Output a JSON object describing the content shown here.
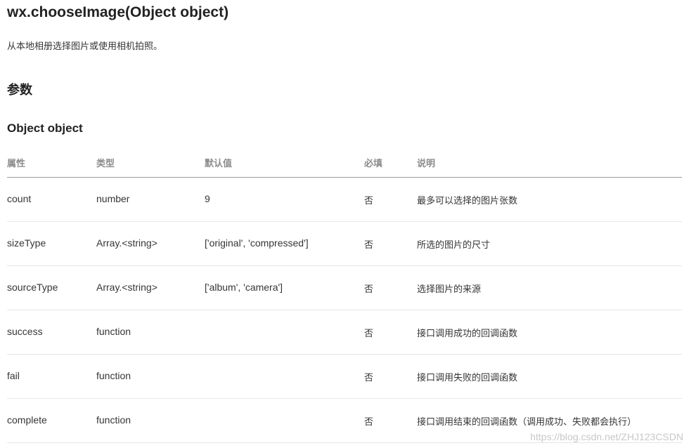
{
  "title": "wx.chooseImage(Object object)",
  "description": "从本地相册选择图片或使用相机拍照。",
  "params_heading": "参数",
  "object_heading": "Object object",
  "table": {
    "headers": [
      "属性",
      "类型",
      "默认值",
      "必填",
      "说明"
    ],
    "rows": [
      [
        "count",
        "number",
        "9",
        "否",
        "最多可以选择的图片张数"
      ],
      [
        "sizeType",
        "Array.<string>",
        "['original', 'compressed']",
        "否",
        "所选的图片的尺寸"
      ],
      [
        "sourceType",
        "Array.<string>",
        "['album', 'camera']",
        "否",
        "选择图片的来源"
      ],
      [
        "success",
        "function",
        "",
        "否",
        "接口调用成功的回调函数"
      ],
      [
        "fail",
        "function",
        "",
        "否",
        "接口调用失败的回调函数"
      ],
      [
        "complete",
        "function",
        "",
        "否",
        "接口调用结束的回调函数（调用成功、失败都会执行）"
      ]
    ]
  },
  "watermark": "https://blog.csdn.net/ZHJ123CSDN"
}
